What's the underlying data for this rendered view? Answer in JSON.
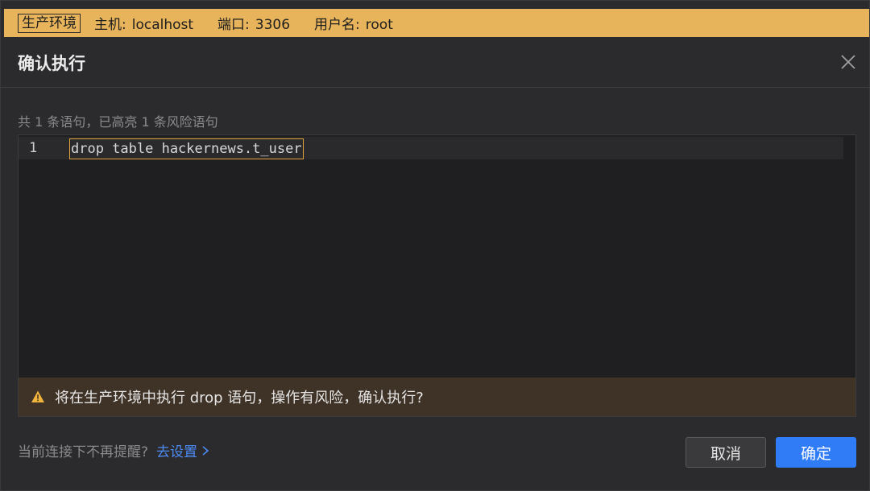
{
  "env_banner": {
    "badge": "生产环境",
    "host_label": "主机:",
    "host_value": "localhost",
    "port_label": "端口:",
    "port_value": "3306",
    "user_label": "用户名:",
    "user_value": "root",
    "color": "#e7b45b"
  },
  "dialog": {
    "title": "确认执行",
    "close_icon": "close-icon"
  },
  "summary": "共 1 条语句，已高亮 1 条风险语句",
  "editor": {
    "lines": [
      {
        "number": "1",
        "code": "drop table hackernews.t_user",
        "highlighted": true
      }
    ],
    "highlight_color": "#e2a53b"
  },
  "warning": {
    "icon": "warning-icon",
    "text": "将在生产环境中执行 drop 语句，操作有风险，确认执行?"
  },
  "footer": {
    "hint": "当前连接下不再提醒?",
    "settings_link": "去设置",
    "cancel_label": "取消",
    "ok_label": "确定",
    "accent_color": "#2f7cf6"
  }
}
